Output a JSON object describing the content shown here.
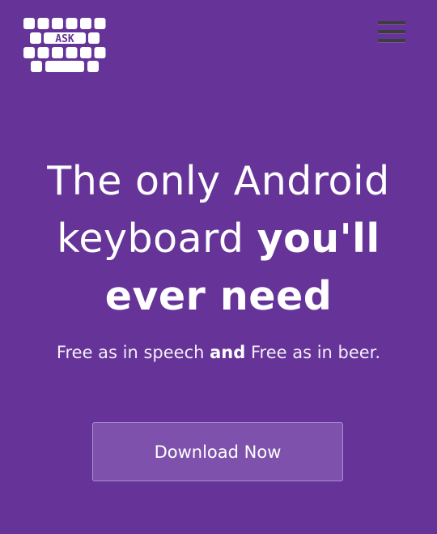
{
  "logo": {
    "text": "ASK",
    "icon": "keyboard-logo-icon"
  },
  "header": {
    "menu_icon": "hamburger-menu-icon"
  },
  "hero": {
    "headline_regular_1": "The only Android",
    "headline_regular_2": "keyboard",
    "headline_bold_1": "you'll",
    "headline_bold_2": "ever need",
    "subtitle_part_1": "Free as in speech",
    "subtitle_bold": "and",
    "subtitle_part_2": "Free as in beer.",
    "cta_label": "Download Now"
  },
  "colors": {
    "background": "#663399",
    "button_fill": "#7e52ac",
    "button_border": "#a98ed0",
    "text": "#ffffff"
  }
}
